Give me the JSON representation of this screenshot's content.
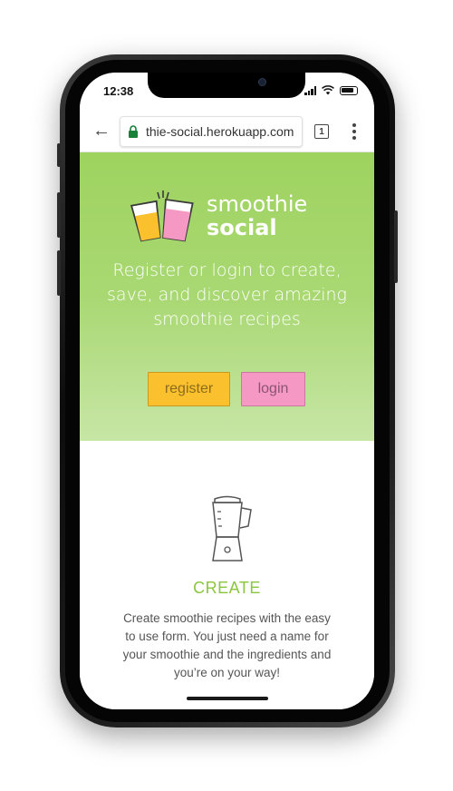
{
  "status": {
    "time": "12:38"
  },
  "browser": {
    "url": "thie-social.herokuapp.com",
    "tab_count": "1"
  },
  "hero": {
    "logo_line1": "smoothie",
    "logo_line2": "social",
    "tagline": "Register or login to create, save, and discover amazing smoothie recipes",
    "register_label": "register",
    "login_label": "login"
  },
  "create": {
    "title": "CREATE",
    "description": "Create smoothie recipes with the easy to use form. You just need a name for your smoothie and the ingredients and you’re on your way!"
  },
  "colors": {
    "hero_green": "#9ed35f",
    "register_yellow": "#fbc02d",
    "login_pink": "#f598c4",
    "create_green": "#8cc63f"
  },
  "icons": [
    "back-arrow-icon",
    "lock-icon",
    "tabs-icon",
    "more-menu-icon",
    "signal-icon",
    "wifi-icon",
    "battery-icon",
    "smoothie-cups-logo",
    "blender-icon"
  ]
}
